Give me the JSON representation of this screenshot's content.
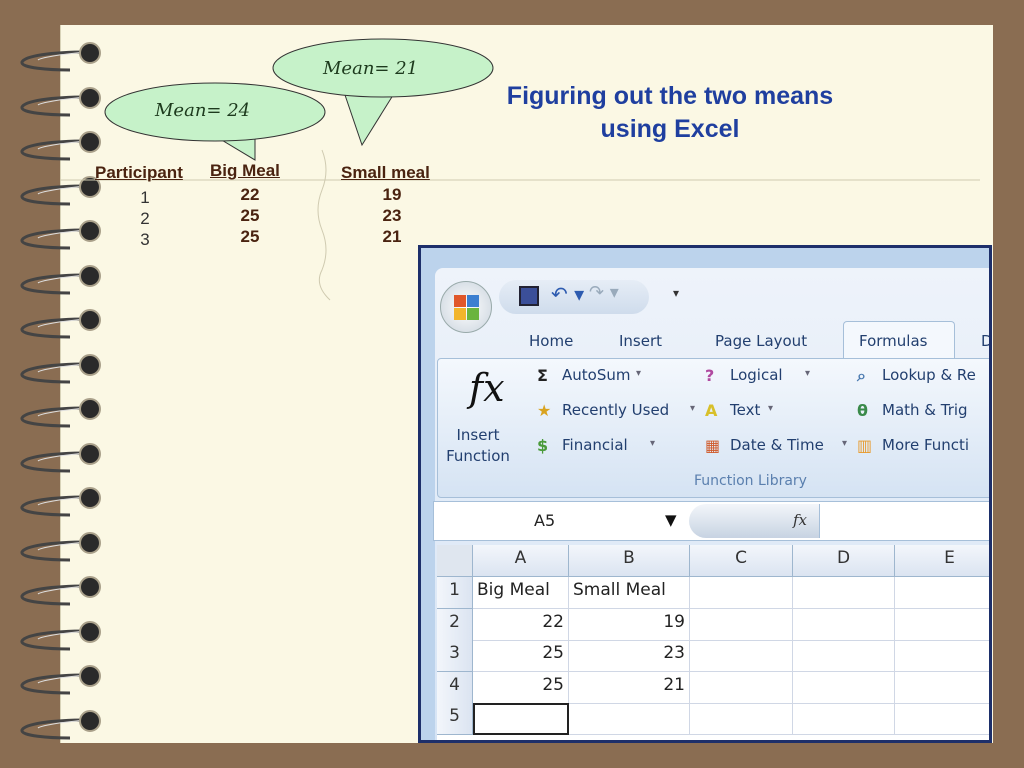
{
  "slide": {
    "title": "Figuring out the two means using Excel",
    "bubbles": [
      {
        "text": "Mean= 21"
      },
      {
        "text": "Mean= 24"
      }
    ],
    "table": {
      "headers": [
        "Participant",
        "Big Meal",
        "Small meal"
      ],
      "rows": [
        [
          "1",
          "22",
          "19"
        ],
        [
          "2",
          "25",
          "23"
        ],
        [
          "3",
          "25",
          "21"
        ]
      ]
    }
  },
  "excel": {
    "tabs": [
      "Home",
      "Insert",
      "Page Layout",
      "Formulas",
      "D"
    ],
    "active_tab": "Formulas",
    "ribbon": {
      "insert_function": "Insert Function",
      "fx": "fx",
      "items": [
        "AutoSum",
        "Recently Used",
        "Financial",
        "Logical",
        "Text",
        "Date & Time",
        "Lookup & Re",
        "Math & Trig",
        "More Functi"
      ],
      "group_label": "Function Library"
    },
    "name_box": "A5",
    "formula_fx": "fx",
    "columns": [
      "A",
      "B",
      "C",
      "D",
      "E"
    ],
    "rows": [
      {
        "n": "1",
        "cells": [
          "Big Meal",
          "Small Meal",
          "",
          "",
          ""
        ]
      },
      {
        "n": "2",
        "cells": [
          "22",
          "19",
          "",
          "",
          ""
        ]
      },
      {
        "n": "3",
        "cells": [
          "25",
          "23",
          "",
          "",
          ""
        ]
      },
      {
        "n": "4",
        "cells": [
          "25",
          "21",
          "",
          "",
          ""
        ]
      },
      {
        "n": "5",
        "cells": [
          "",
          "",
          "",
          "",
          ""
        ]
      }
    ]
  }
}
